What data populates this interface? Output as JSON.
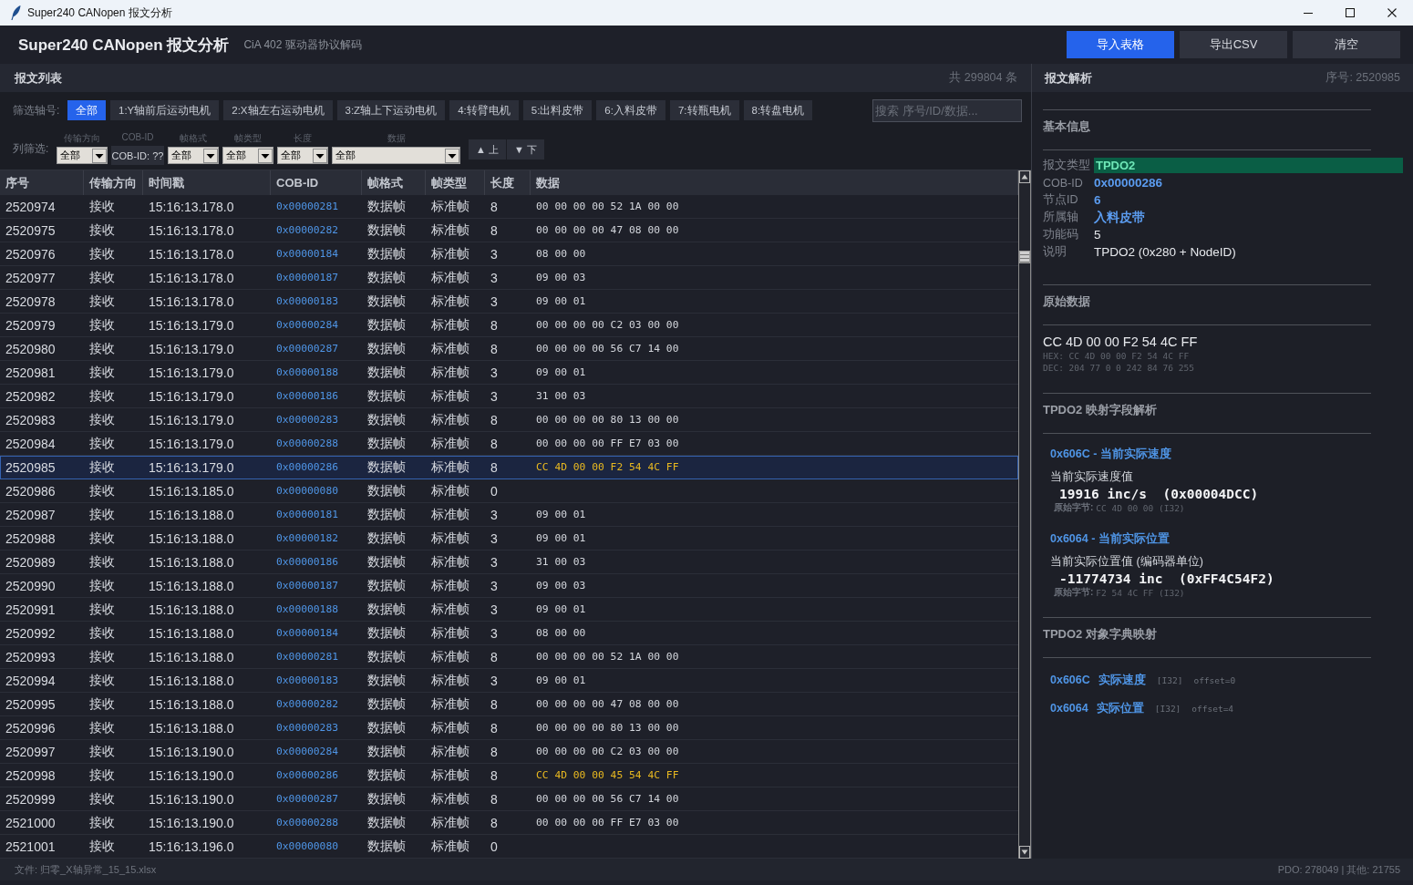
{
  "window": {
    "title": "Super240 CANopen 报文分析"
  },
  "header": {
    "title": "Super240 CANopen 报文分析",
    "subtitle": "CiA 402 驱动器协议解码",
    "buttons": [
      {
        "label": "导入表格",
        "kind": "primary"
      },
      {
        "label": "导出CSV",
        "kind": "secondary"
      },
      {
        "label": "清空",
        "kind": "secondary"
      }
    ]
  },
  "message_list": {
    "title": "报文列表",
    "count": "共 299804 条",
    "axis_filter": {
      "label": "筛选轴号:",
      "options": [
        {
          "label": "全部",
          "selected": true
        },
        {
          "label": "1:Y轴前后运动电机",
          "selected": false
        },
        {
          "label": "2:X轴左右运动电机",
          "selected": false
        },
        {
          "label": "3:Z轴上下运动电机",
          "selected": false
        },
        {
          "label": "4:转臂电机",
          "selected": false
        },
        {
          "label": "5:出料皮带",
          "selected": false
        },
        {
          "label": "6:入料皮带",
          "selected": false
        },
        {
          "label": "7:转瓶电机",
          "selected": false
        },
        {
          "label": "8:转盘电机",
          "selected": false
        }
      ]
    },
    "search": {
      "placeholder": "搜索 序号/ID/数据..."
    },
    "column_filter": {
      "label": "列筛选:",
      "filters": [
        {
          "caption": "传输方向",
          "kind": "dropdown",
          "value": "全部"
        },
        {
          "caption": "COB-ID",
          "kind": "button",
          "value": "COB-ID: ??"
        },
        {
          "caption": "帧格式",
          "kind": "dropdown",
          "value": "全部"
        },
        {
          "caption": "帧类型",
          "kind": "dropdown",
          "value": "全部"
        },
        {
          "caption": "长度",
          "kind": "dropdown",
          "value": "全部"
        },
        {
          "caption": "数据",
          "kind": "dropdown",
          "value": "全部"
        }
      ]
    },
    "nav_buttons": [
      "▲ 上",
      "▼ 下"
    ],
    "table": {
      "columns": [
        "序号",
        "传输方向",
        "时间戳",
        "COB-ID",
        "帧格式",
        "帧类型",
        "长度",
        "数据"
      ],
      "rows": [
        {
          "seq": "2520974",
          "direction": "接收",
          "time": "15:16:13.178.0",
          "cob_id": "0x00000281",
          "format": "数据帧",
          "frame_type": "标准帧",
          "length": "8",
          "data": "00 00 00 00 52 1A 00 00",
          "selected": false,
          "highlighted": false
        },
        {
          "seq": "2520975",
          "direction": "接收",
          "time": "15:16:13.178.0",
          "cob_id": "0x00000282",
          "format": "数据帧",
          "frame_type": "标准帧",
          "length": "8",
          "data": "00 00 00 00 47 08 00 00",
          "selected": false,
          "highlighted": false
        },
        {
          "seq": "2520976",
          "direction": "接收",
          "time": "15:16:13.178.0",
          "cob_id": "0x00000184",
          "format": "数据帧",
          "frame_type": "标准帧",
          "length": "3",
          "data": "08 00 00",
          "selected": false,
          "highlighted": false
        },
        {
          "seq": "2520977",
          "direction": "接收",
          "time": "15:16:13.178.0",
          "cob_id": "0x00000187",
          "format": "数据帧",
          "frame_type": "标准帧",
          "length": "3",
          "data": "09 00 03",
          "selected": false,
          "highlighted": false
        },
        {
          "seq": "2520978",
          "direction": "接收",
          "time": "15:16:13.178.0",
          "cob_id": "0x00000183",
          "format": "数据帧",
          "frame_type": "标准帧",
          "length": "3",
          "data": "09 00 01",
          "selected": false,
          "highlighted": false
        },
        {
          "seq": "2520979",
          "direction": "接收",
          "time": "15:16:13.179.0",
          "cob_id": "0x00000284",
          "format": "数据帧",
          "frame_type": "标准帧",
          "length": "8",
          "data": "00 00 00 00 C2 03 00 00",
          "selected": false,
          "highlighted": false
        },
        {
          "seq": "2520980",
          "direction": "接收",
          "time": "15:16:13.179.0",
          "cob_id": "0x00000287",
          "format": "数据帧",
          "frame_type": "标准帧",
          "length": "8",
          "data": "00 00 00 00 56 C7 14 00",
          "selected": false,
          "highlighted": false
        },
        {
          "seq": "2520981",
          "direction": "接收",
          "time": "15:16:13.179.0",
          "cob_id": "0x00000188",
          "format": "数据帧",
          "frame_type": "标准帧",
          "length": "3",
          "data": "09 00 01",
          "selected": false,
          "highlighted": false
        },
        {
          "seq": "2520982",
          "direction": "接收",
          "time": "15:16:13.179.0",
          "cob_id": "0x00000186",
          "format": "数据帧",
          "frame_type": "标准帧",
          "length": "3",
          "data": "31 00 03",
          "selected": false,
          "highlighted": false
        },
        {
          "seq": "2520983",
          "direction": "接收",
          "time": "15:16:13.179.0",
          "cob_id": "0x00000283",
          "format": "数据帧",
          "frame_type": "标准帧",
          "length": "8",
          "data": "00 00 00 00 80 13 00 00",
          "selected": false,
          "highlighted": false
        },
        {
          "seq": "2520984",
          "direction": "接收",
          "time": "15:16:13.179.0",
          "cob_id": "0x00000288",
          "format": "数据帧",
          "frame_type": "标准帧",
          "length": "8",
          "data": "00 00 00 00 FF E7 03 00",
          "selected": false,
          "highlighted": false
        },
        {
          "seq": "2520985",
          "direction": "接收",
          "time": "15:16:13.179.0",
          "cob_id": "0x00000286",
          "format": "数据帧",
          "frame_type": "标准帧",
          "length": "8",
          "data": "CC 4D 00 00 F2 54 4C FF",
          "selected": true,
          "highlighted": true
        },
        {
          "seq": "2520986",
          "direction": "接收",
          "time": "15:16:13.185.0",
          "cob_id": "0x00000080",
          "format": "数据帧",
          "frame_type": "标准帧",
          "length": "0",
          "selected": false
        },
        {
          "seq": "2520987",
          "direction": "接收",
          "time": "15:16:13.188.0",
          "cob_id": "0x00000181",
          "format": "数据帧",
          "frame_type": "标准帧",
          "length": "3",
          "data": "09 00 01",
          "selected": false,
          "highlighted": false
        },
        {
          "seq": "2520988",
          "direction": "接收",
          "time": "15:16:13.188.0",
          "cob_id": "0x00000182",
          "format": "数据帧",
          "frame_type": "标准帧",
          "length": "3",
          "data": "09 00 01",
          "selected": false,
          "highlighted": false
        },
        {
          "seq": "2520989",
          "direction": "接收",
          "time": "15:16:13.188.0",
          "cob_id": "0x00000186",
          "format": "数据帧",
          "frame_type": "标准帧",
          "length": "3",
          "data": "31 00 03",
          "selected": false,
          "highlighted": false
        },
        {
          "seq": "2520990",
          "direction": "接收",
          "time": "15:16:13.188.0",
          "cob_id": "0x00000187",
          "format": "数据帧",
          "frame_type": "标准帧",
          "length": "3",
          "data": "09 00 03",
          "selected": false,
          "highlighted": false
        },
        {
          "seq": "2520991",
          "direction": "接收",
          "time": "15:16:13.188.0",
          "cob_id": "0x00000188",
          "format": "数据帧",
          "frame_type": "标准帧",
          "length": "3",
          "data": "09 00 01",
          "selected": false,
          "highlighted": false
        },
        {
          "seq": "2520992",
          "direction": "接收",
          "time": "15:16:13.188.0",
          "cob_id": "0x00000184",
          "format": "数据帧",
          "frame_type": "标准帧",
          "length": "3",
          "data": "08 00 00",
          "selected": false,
          "highlighted": false
        },
        {
          "seq": "2520993",
          "direction": "接收",
          "time": "15:16:13.188.0",
          "cob_id": "0x00000281",
          "format": "数据帧",
          "frame_type": "标准帧",
          "length": "8",
          "data": "00 00 00 00 52 1A 00 00",
          "selected": false,
          "highlighted": false
        },
        {
          "seq": "2520994",
          "direction": "接收",
          "time": "15:16:13.188.0",
          "cob_id": "0x00000183",
          "format": "数据帧",
          "frame_type": "标准帧",
          "length": "3",
          "data": "09 00 01",
          "selected": false,
          "highlighted": false
        },
        {
          "seq": "2520995",
          "direction": "接收",
          "time": "15:16:13.188.0",
          "cob_id": "0x00000282",
          "format": "数据帧",
          "frame_type": "标准帧",
          "length": "8",
          "data": "00 00 00 00 47 08 00 00",
          "selected": false,
          "highlighted": false
        },
        {
          "seq": "2520996",
          "direction": "接收",
          "time": "15:16:13.188.0",
          "cob_id": "0x00000283",
          "format": "数据帧",
          "frame_type": "标准帧",
          "length": "8",
          "data": "00 00 00 00 80 13 00 00",
          "selected": false,
          "highlighted": false
        },
        {
          "seq": "2520997",
          "direction": "接收",
          "time": "15:16:13.190.0",
          "cob_id": "0x00000284",
          "format": "数据帧",
          "frame_type": "标准帧",
          "length": "8",
          "data": "00 00 00 00 C2 03 00 00",
          "selected": false,
          "highlighted": false
        },
        {
          "seq": "2520998",
          "direction": "接收",
          "time": "15:16:13.190.0",
          "cob_id": "0x00000286",
          "format": "数据帧",
          "frame_type": "标准帧",
          "length": "8",
          "data": "CC 4D 00 00 45 54 4C FF",
          "selected": false,
          "highlighted": true
        },
        {
          "seq": "2520999",
          "direction": "接收",
          "time": "15:16:13.190.0",
          "cob_id": "0x00000287",
          "format": "数据帧",
          "frame_type": "标准帧",
          "length": "8",
          "data": "00 00 00 00 56 C7 14 00",
          "selected": false,
          "highlighted": false
        },
        {
          "seq": "2521000",
          "direction": "接收",
          "time": "15:16:13.190.0",
          "cob_id": "0x00000288",
          "format": "数据帧",
          "frame_type": "标准帧",
          "length": "8",
          "data": "00 00 00 00 FF E7 03 00",
          "selected": false,
          "highlighted": false
        },
        {
          "seq": "2521001",
          "direction": "接收",
          "time": "15:16:13.196.0",
          "cob_id": "0x00000080",
          "format": "数据帧",
          "frame_type": "标准帧",
          "length": "0",
          "selected": false
        }
      ]
    }
  },
  "decode_panel": {
    "title": "报文解析",
    "sequence": "序号: 2520985",
    "sections": [
      {
        "kind": "info",
        "title": "基本信息",
        "fields": [
          {
            "label": "报文类型",
            "value": "TPDO2",
            "kind": "tag"
          },
          {
            "label": "COB-ID",
            "value": "0x00000286",
            "kind": "accent"
          },
          {
            "label": "节点ID",
            "value": "6",
            "kind": "accent"
          },
          {
            "label": "所属轴",
            "value": "入料皮带",
            "kind": "accent"
          },
          {
            "label": "功能码",
            "value": "5",
            "kind": "plain"
          },
          {
            "label": "说明",
            "value": "TPDO2 (0x280 + NodeID)",
            "kind": "plain"
          }
        ]
      },
      {
        "kind": "raw",
        "title": "原始数据",
        "bytes": "CC 4D 00 00 F2 54 4C FF",
        "hex": "HEX: CC 4D 00 00 F2 54 4C FF",
        "dec": "DEC: 204 77 0 0 242 84 76 255"
      },
      {
        "kind": "fields",
        "title": "TPDO2 映射字段解析",
        "items": [
          {
            "heading": "0x606C - 当前实际速度",
            "caption": "当前实际速度值",
            "value": "19916 inc/s  (0x00004DCC)",
            "raw_label": "原始字节:",
            "raw": "CC 4D 00 00 (I32)"
          },
          {
            "heading": "0x6064 - 当前实际位置",
            "caption": "当前实际位置值 (编码器单位)",
            "value": "-11774734 inc  (0xFF4C54F2)",
            "raw_label": "原始字节:",
            "raw": "F2 54 4C FF (I32)"
          }
        ]
      },
      {
        "kind": "mapping",
        "title": "TPDO2 对象字典映射",
        "entries": [
          {
            "index": "0x606C",
            "name": "实际速度",
            "type": "[I32]",
            "offset": "offset=0"
          },
          {
            "index": "0x6064",
            "name": "实际位置",
            "type": "[I32]",
            "offset": "offset=4"
          }
        ]
      }
    ]
  },
  "status_bar": {
    "file": "文件: 归零_X轴异常_15_15.xlsx",
    "counts": "PDO: 278049 | 其他: 21755"
  }
}
